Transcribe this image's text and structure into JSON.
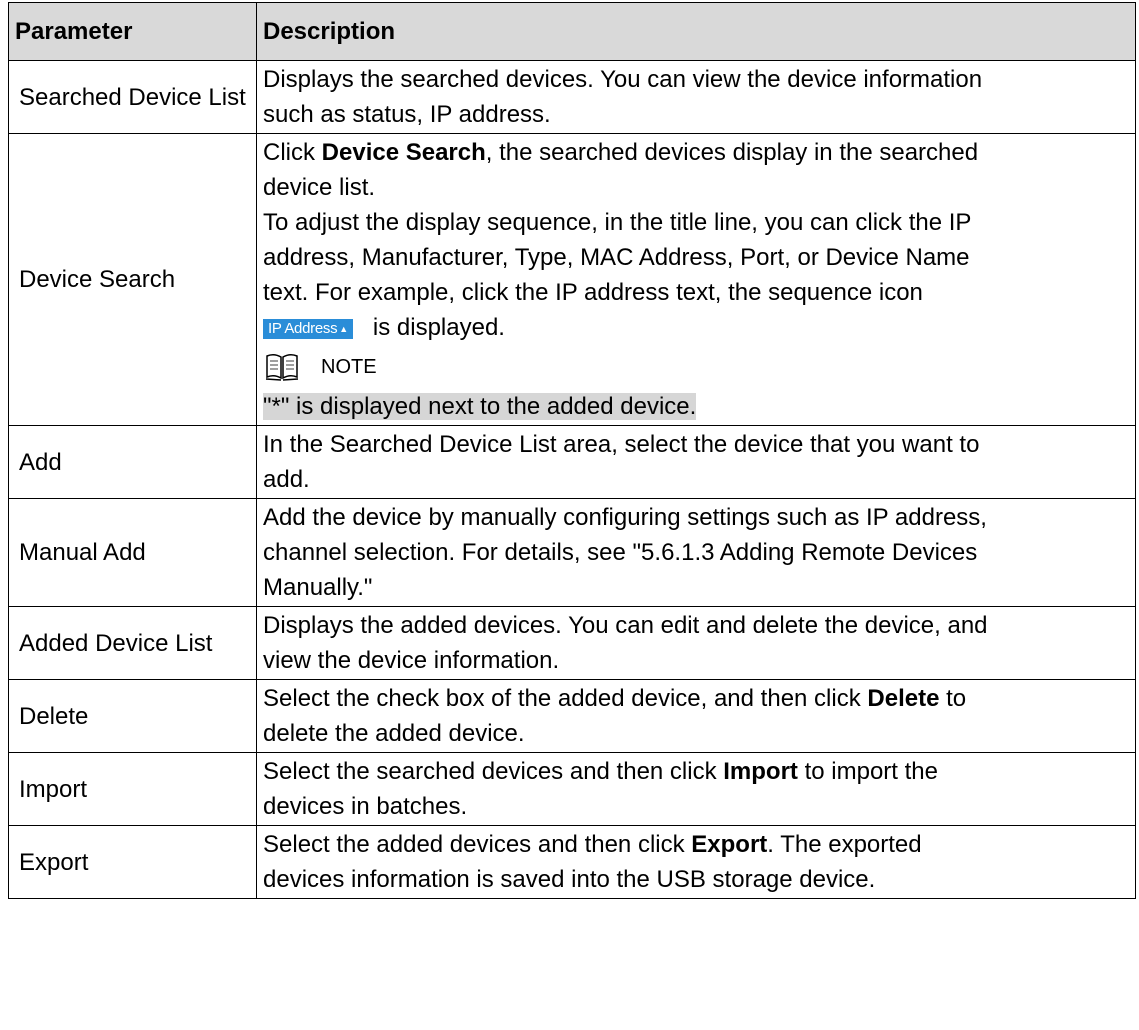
{
  "table": {
    "headers": [
      "Parameter",
      "Description"
    ],
    "rows": [
      {
        "param": "Searched Device List",
        "lines": [
          "Displays the searched devices. You can view the device information",
          "such as status, IP address."
        ]
      },
      {
        "param": "Device Search",
        "line1_pre": "Click ",
        "line1_bold": "Device Search",
        "line1_post": ", the searched devices display in the searched",
        "line2": "device list.",
        "line3": "To adjust the display sequence, in the title line, you can click the IP",
        "line4": "address, Manufacturer, Type, MAC Address, Port, or Device Name",
        "line5": "text. For example, click the IP address text, the sequence icon",
        "chip_label": "IP Address",
        "chip_arrow": "▲",
        "line6_post": "is displayed.",
        "note_label": "NOTE",
        "note_icon": "book-note-icon",
        "note_text": "\"*\" is displayed next to the added device."
      },
      {
        "param": "Add",
        "lines": [
          "In the Searched Device List area, select the device that you want to",
          "add."
        ]
      },
      {
        "param": "Manual Add",
        "lines": [
          "Add the device by manually configuring settings such as IP address,",
          "channel selection. For details, see \"5.6.1.3 Adding Remote Devices",
          "Manually.\""
        ]
      },
      {
        "param": "Added Device List",
        "lines": [
          "Displays the added devices. You can edit and delete the device, and",
          "view the device information."
        ]
      },
      {
        "param": "Delete",
        "line1_pre": "Select the check box of the added device, and then click ",
        "line1_bold": "Delete",
        "line1_post": " to",
        "line2": "delete the added device."
      },
      {
        "param": "Import",
        "line1_pre": "Select the searched devices and then click ",
        "line1_bold": "Import",
        "line1_post": " to import the",
        "line2": "devices in batches."
      },
      {
        "param": "Export",
        "line1_pre": "Select the added devices and then click ",
        "line1_bold": "Export",
        "line1_post": ". The exported",
        "line2": "devices information is saved into the USB storage device."
      }
    ]
  },
  "colors": {
    "header_bg": "#d9d9d9",
    "chip_bg": "#2a8dd8",
    "highlight_bg": "#d6d6d6"
  }
}
